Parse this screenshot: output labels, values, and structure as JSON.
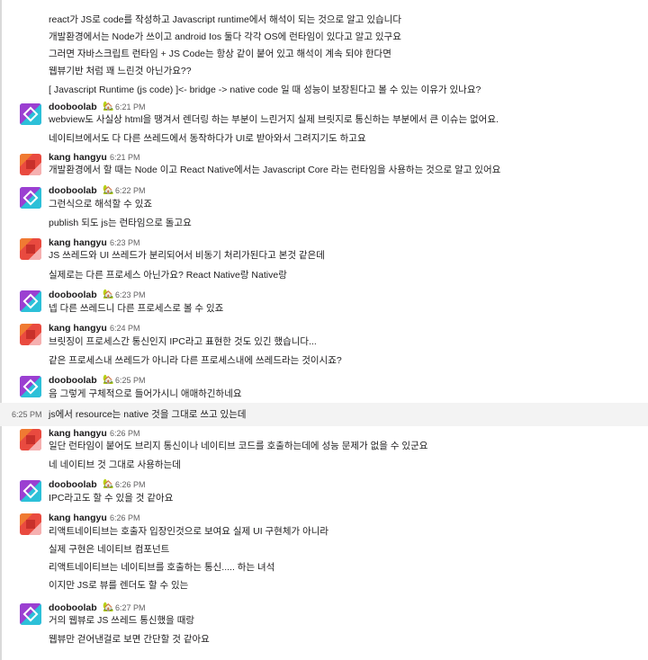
{
  "messages": [
    {
      "author": null,
      "lines": [
        "react가 JS로 code를 작성하고 Javascript runtime에서 해석이 되는 것으로 알고 있습니다",
        "개발환경에서는 Node가 쓰이고 android Ios 둘다 각각 OS에 런타임이 있다고 알고 있구요",
        "그러면 자바스크립트 런타임 + JS Code는 항상 같이 붙어 있고 해석이 계속 되야 한다면",
        "웹뷰기반 처럼 꽤 느린것 아닌가요??",
        "[ Javascript Runtime (js code) ]<- bridge -> native code 일 때 성능이 보장된다고 볼 수 있는 이유가 있나요?"
      ]
    },
    {
      "author": "dooboolab",
      "emoji": "🏡",
      "time": "6:21 PM",
      "lines": [
        "webview도 사실상 html을 땡겨서 렌더링 하는 부분이 느린거지 실제 브릿지로 통신하는 부분에서 큰 이슈는 없어요.",
        "네이티브에서도 다 다른 쓰레드에서 동작하다가 UI로 받아와서 그려지기도 하고요"
      ]
    },
    {
      "author": "kang hangyu",
      "time": "6:21 PM",
      "lines": [
        "개발환경에서 할 때는 Node 이고 React Native에서는 Javascript Core 라는 런타임을 사용하는 것으로 알고 있어요"
      ]
    },
    {
      "author": "dooboolab",
      "emoji": "🏡",
      "time": "6:22 PM",
      "lines": [
        "그런식으로 해석할 수 있죠",
        "publish 되도 js는 런타임으로 돌고요"
      ]
    },
    {
      "author": "kang hangyu",
      "time": "6:23 PM",
      "lines": [
        "JS 쓰레드와 UI 쓰레드가 분리되어서 비동기 처리가된다고 본것 같은데",
        "실제로는 다른 프로세스 아닌가요? React Native랑 Native랑"
      ]
    },
    {
      "author": "dooboolab",
      "emoji": "🏡",
      "time": "6:23 PM",
      "lines": [
        "넵 다른 쓰레드니 다른 프로세스로 볼 수 있죠"
      ]
    },
    {
      "author": "kang hangyu",
      "time": "6:24 PM",
      "lines": [
        "브릿징이 프로세스간 통신인지 IPC라고 표현한 것도 있긴 했습니다...",
        "같은 프로세스내 쓰레드가 아니라 다른 프로세스내에 쓰레드라는 것이시죠?"
      ]
    },
    {
      "author": "dooboolab",
      "emoji": "🏡",
      "time": "6:25 PM",
      "lines": [
        "음 그렇게 구체적으로 들어가시니 애매하긴하네요"
      ]
    },
    {
      "author": null,
      "side_time": "6:25 PM",
      "lines": [
        "js에서 resource는 native 것을 그대로 쓰고 있는데"
      ]
    },
    {
      "author": "kang hangyu",
      "time": "6:26 PM",
      "lines": [
        "일단 런타임이 붙어도 브리지 통신이나 네이티브 코드를 호출하는데에 성능 문제가 없을 수 있군요",
        "네 네이티브 것 그대로 사용하는데"
      ]
    },
    {
      "author": "dooboolab",
      "emoji": "🏡",
      "time": "6:26 PM",
      "lines": [
        "IPC라고도 할 수 있을 것 같아요"
      ]
    },
    {
      "author": "kang hangyu",
      "time": "6:26 PM",
      "lines": [
        "리액트네이티브는 호출자 입장인것으로 보여요 실제 UI 구현체가 아니라",
        "실제 구현은 네이티브 컴포넌트",
        "리액트네이티브는 네이티브를 호출하는 통신..... 하는 녀석",
        "이지만 JS로 뷰를 렌더도 할 수 있는"
      ]
    },
    {
      "author": "dooboolab",
      "emoji": "🏡",
      "time": "6:27 PM",
      "lines": [
        "거의 웹뷰로 JS 쓰레드 통신했을 때랑",
        "웹뷰만 걷어낸걸로 보면 간단할 것 같아요"
      ]
    }
  ]
}
